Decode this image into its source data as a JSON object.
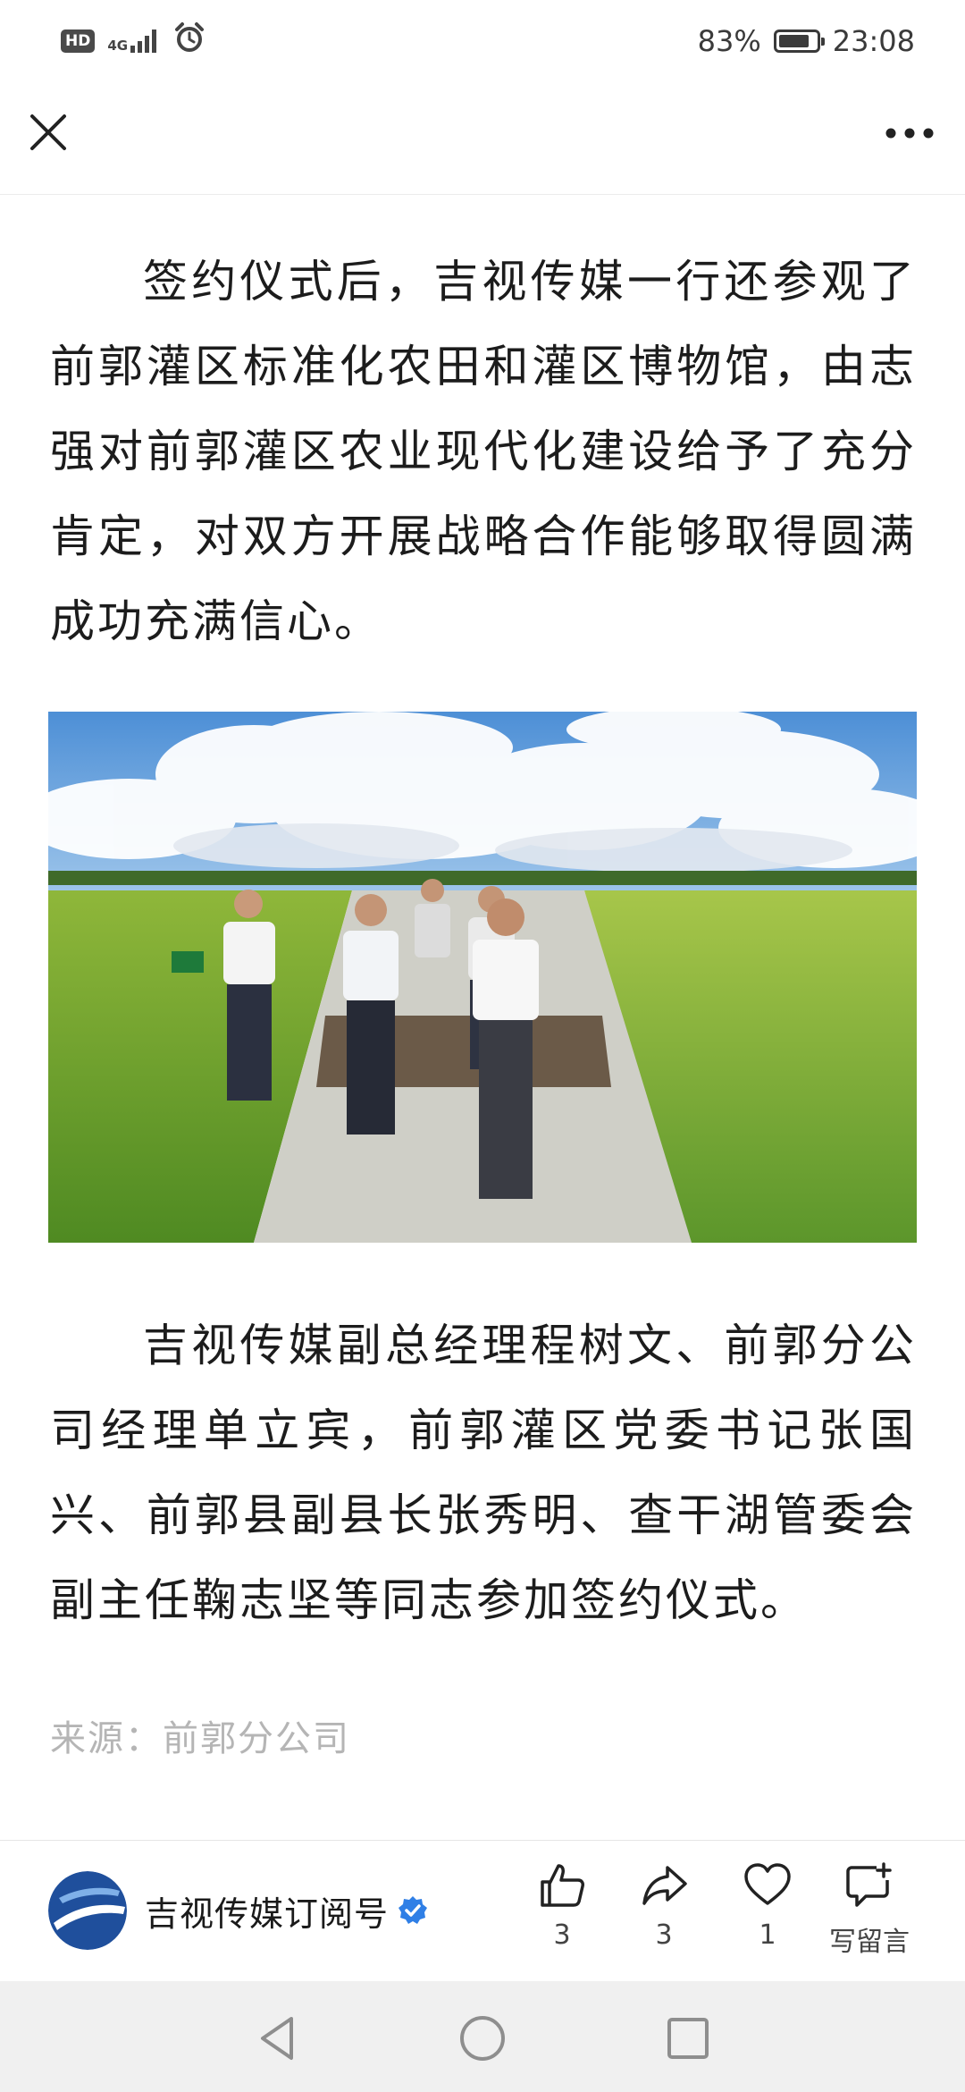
{
  "status_bar": {
    "hd_badge": "HD",
    "network": "4G",
    "battery_percent": "83%",
    "battery_level": 0.83,
    "time": "23:08",
    "icons": [
      "hd-icon",
      "signal-icon",
      "alarm-icon",
      "battery-icon"
    ]
  },
  "nav": {
    "close_icon": "close-icon",
    "more_icon": "more-icon"
  },
  "article": {
    "paragraph_1": "签约仪式后，吉视传媒一行还参观了前郭灌区标准化农田和灌区博物馆，由志强对前郭灌区农业现代化建设给予了充分肯定，对双方开展战略合作能够取得圆满成功充满信心。",
    "paragraph_2": "吉视传媒副总经理程树文、前郭分公司经理单立宾，前郭灌区党委书记张国兴、前郭县副县长张秀明、查干湖管委会副主任鞠志坚等同志参加签约仪式。",
    "source": "来源：前郭分公司"
  },
  "footer": {
    "account_name": "吉视传媒订阅号",
    "like_count": "3",
    "share_count": "3",
    "favorite_count": "1",
    "comment_label": "写留言"
  },
  "colors": {
    "verified_blue": "#2f7fe6",
    "logo_blue": "#1f4f9c",
    "source_gray": "#b5b5b5"
  }
}
